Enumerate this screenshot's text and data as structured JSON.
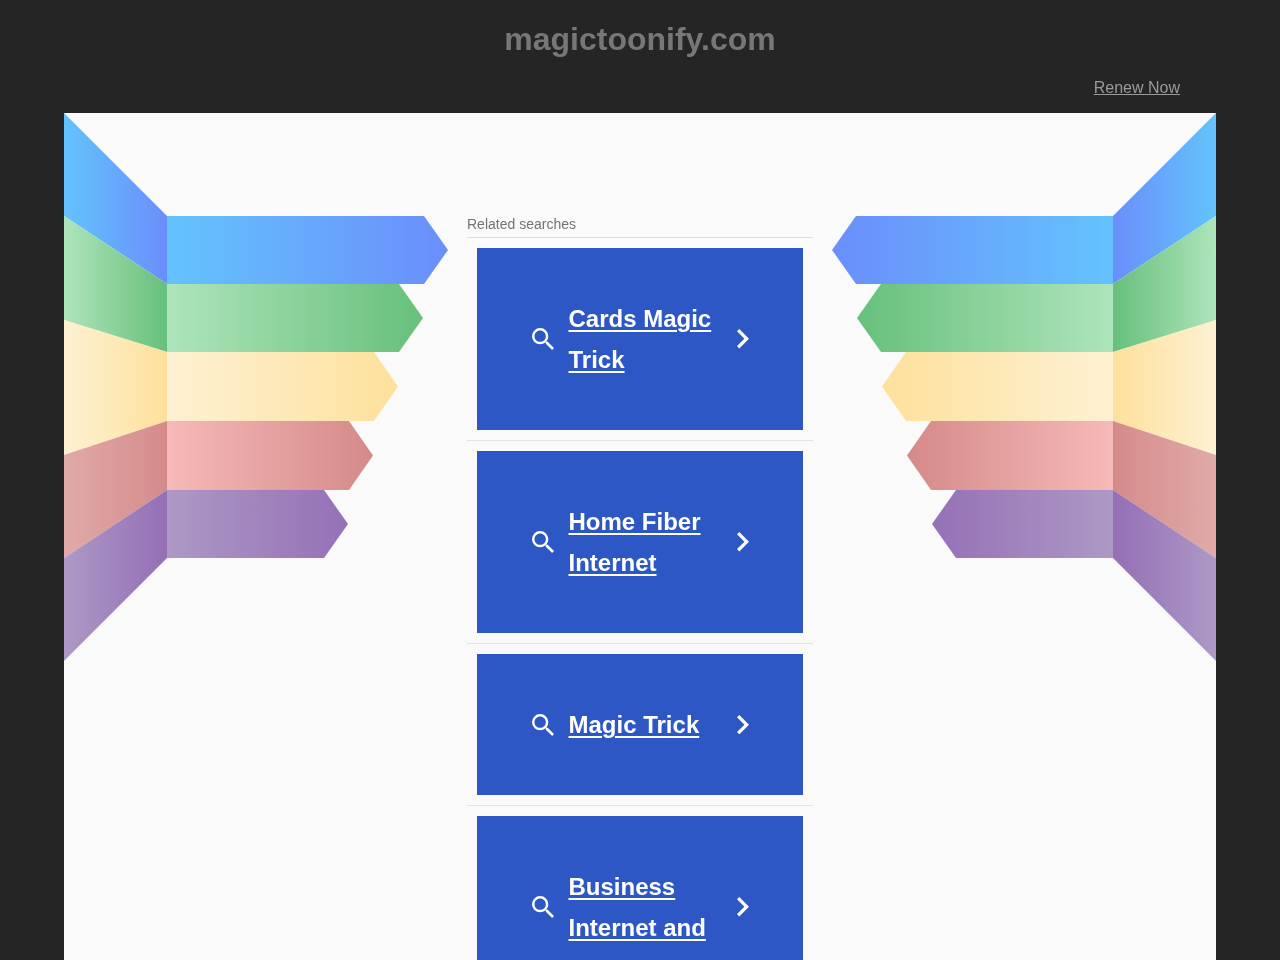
{
  "header": {
    "domain": "magictoonify.com",
    "renew_link": "Renew Now"
  },
  "related_searches": {
    "heading": "Related searches",
    "links": [
      "Cards Magic Trick",
      "Home Fiber Internet",
      "Magic Trick",
      "Business Internet and"
    ]
  }
}
